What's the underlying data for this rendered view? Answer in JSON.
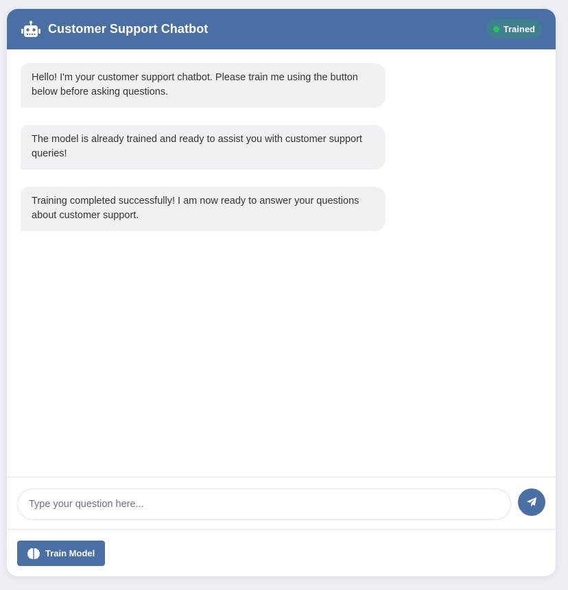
{
  "header": {
    "title": "Customer Support Chatbot",
    "status": "Trained",
    "icon": "robot-icon",
    "status_color": "#22c55e"
  },
  "messages": [
    {
      "sender": "bot",
      "text": "Hello! I'm your customer support chatbot. Please train me using the button below before asking questions."
    },
    {
      "sender": "bot",
      "text": "The model is already trained and ready to assist you with customer support queries!"
    },
    {
      "sender": "bot",
      "text": "Training completed successfully! I am now ready to answer your questions about customer support."
    }
  ],
  "input": {
    "placeholder": "Type your question here...",
    "value": ""
  },
  "send_button": {
    "icon": "paper-plane-icon"
  },
  "train_button": {
    "label": "Train Model",
    "icon": "brain-icon"
  },
  "colors": {
    "accent": "#4a6fa5",
    "bubble": "#f0f1f5",
    "background": "#eef0f5"
  }
}
